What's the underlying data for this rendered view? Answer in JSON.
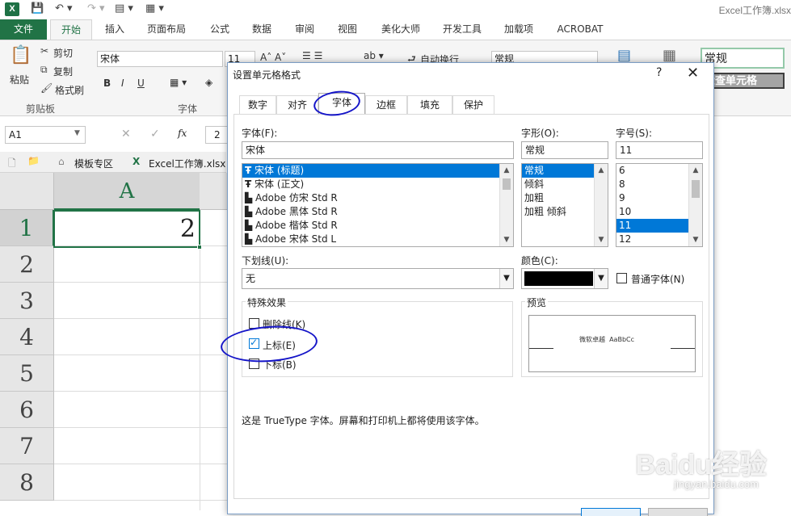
{
  "window": {
    "title": "Excel工作簿.xlsx"
  },
  "ribbon_tabs": [
    "文件",
    "开始",
    "插入",
    "页面布局",
    "公式",
    "数据",
    "审阅",
    "视图",
    "美化大师",
    "开发工具",
    "加载项",
    "ACROBAT"
  ],
  "ribbon": {
    "paste": "粘贴",
    "cut": "剪切",
    "copy": "复制",
    "format_painter": "格式刷",
    "clipboard_group": "剪贴板",
    "font_name": "宋体",
    "font_size": "11",
    "font_group": "字体",
    "bold": "B",
    "italic": "I",
    "underline": "U",
    "wrap_text": "自动换行",
    "number_format": "常规",
    "style_name": "常规",
    "check_cell": "检查单元格"
  },
  "formula_bar": {
    "name_box": "A1",
    "value": "2",
    "fx": "fx"
  },
  "doc_tabs": {
    "template": "模板专区",
    "workbook": "Excel工作簿.xlsx"
  },
  "sheet": {
    "column_header": "A",
    "rows": [
      "1",
      "2",
      "3",
      "4",
      "5",
      "6",
      "7",
      "8"
    ],
    "a1_value": "2"
  },
  "dialog": {
    "title": "设置单元格格式",
    "help": "?",
    "tabs": [
      "数字",
      "对齐",
      "字体",
      "边框",
      "填充",
      "保护"
    ],
    "active_tab": "字体",
    "font_label": "字体(F):",
    "font_value": "宋体",
    "font_list": [
      "宋体 (标题)",
      "宋体 (正文)",
      "Adobe 仿宋 Std R",
      "Adobe 黑体 Std R",
      "Adobe 楷体 Std R",
      "Adobe 宋体 Std L"
    ],
    "style_label": "字形(O):",
    "style_value": "常规",
    "style_list": [
      "常规",
      "倾斜",
      "加粗",
      "加粗 倾斜"
    ],
    "size_label": "字号(S):",
    "size_value": "11",
    "size_list": [
      "6",
      "8",
      "9",
      "10",
      "11",
      "12"
    ],
    "underline_label": "下划线(U):",
    "underline_value": "无",
    "color_label": "颜色(C):",
    "color_value": "#000000",
    "normal_font_label": "普通字体(N)",
    "effects_legend": "特殊效果",
    "strikethrough_label": "删除线(K)",
    "superscript_label": "上标(E)",
    "subscript_label": "下标(B)",
    "superscript_checked": true,
    "preview_legend": "预览",
    "preview_text": "微软卓越  AaBbCc",
    "info_text": "这是 TrueType 字体。屏幕和打印机上都将使用该字体。"
  },
  "watermark": {
    "logo": "Baidu经验",
    "url": "jingyan.baidu.com"
  },
  "colors": {
    "excel_green": "#217346",
    "selection_blue": "#0078d7",
    "annotation_blue": "#1515c8"
  }
}
